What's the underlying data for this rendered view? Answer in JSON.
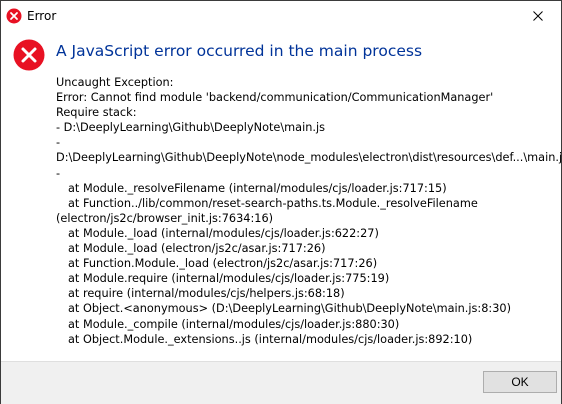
{
  "window": {
    "title": "Error",
    "close_icon": "close-icon",
    "title_icon": "error-icon"
  },
  "dialog": {
    "icon": "error-icon",
    "icon_color": "#e81123",
    "heading": "A JavaScript error occurred in the main process",
    "heading_color": "#003399",
    "lines": [
      "Uncaught Exception:",
      "Error: Cannot find module 'backend/communication/CommunicationManager'",
      "Require stack:",
      "- D:\\DeeplyLearning\\Github\\DeeplyNote\\main.js",
      "-",
      "D:\\DeeplyLearning\\Github\\DeeplyNote\\node_modules\\electron\\dist\\resources\\def...\\main.js",
      "-",
      "    at Module._resolveFilename (internal/modules/cjs/loader.js:717:15)",
      "    at Function../lib/common/reset-search-paths.ts.Module._resolveFilename",
      "(electron/js2c/browser_init.js:7634:16)",
      "    at Module._load (internal/modules/cjs/loader.js:622:27)",
      "    at Module._load (electron/js2c/asar.js:717:26)",
      "    at Function.Module._load (electron/js2c/asar.js:717:26)",
      "    at Module.require (internal/modules/cjs/loader.js:775:19)",
      "    at require (internal/modules/cjs/helpers.js:68:18)",
      "    at Object.<anonymous> (D:\\DeeplyLearning\\Github\\DeeplyNote\\main.js:8:30)",
      "    at Module._compile (internal/modules/cjs/loader.js:880:30)",
      "    at Object.Module._extensions..js (internal/modules/cjs/loader.js:892:10)"
    ]
  },
  "footer": {
    "ok_label": "OK"
  }
}
